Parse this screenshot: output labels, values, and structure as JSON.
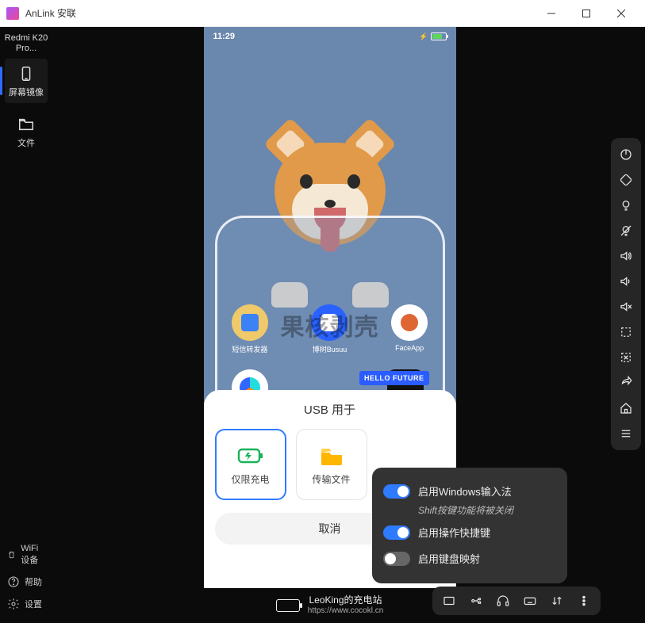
{
  "titlebar": {
    "title": "AnLink 安联"
  },
  "device_name": "Redmi K20 Pro...",
  "left_nav": {
    "mirror": "屏幕镜像",
    "files": "文件",
    "wifi": "WiFi设备",
    "help": "帮助",
    "settings": "设置"
  },
  "statusbar": {
    "time": "11:29"
  },
  "apps_row1": [
    "短信转发器",
    "博树Busuu",
    "FaceApp"
  ],
  "hello_badge": "HELLO FUTURE",
  "sheet": {
    "title": "USB 用于",
    "opt_charge": "仅限充电",
    "opt_files": "传输文件",
    "cancel": "取消"
  },
  "footer": {
    "station": "LeoKing的充电站",
    "url": "https://www.cocokl.cn"
  },
  "popover": {
    "enable_ime": "启用Windows输入法",
    "ime_hint": "Shift按键功能将被关闭",
    "enable_shortcut": "启用操作快捷键",
    "enable_keymap": "启用键盘映射",
    "ime_on": true,
    "shortcut_on": true,
    "keymap_on": false
  },
  "right_tools": [
    "power",
    "rotate",
    "bulb-on",
    "bulb-off",
    "volume-up",
    "volume-down",
    "mute",
    "crop",
    "expand",
    "back",
    "home",
    "menu"
  ],
  "bottom_tools": [
    "fullscreen",
    "usb",
    "headset",
    "keyboard",
    "transfer",
    "more"
  ]
}
